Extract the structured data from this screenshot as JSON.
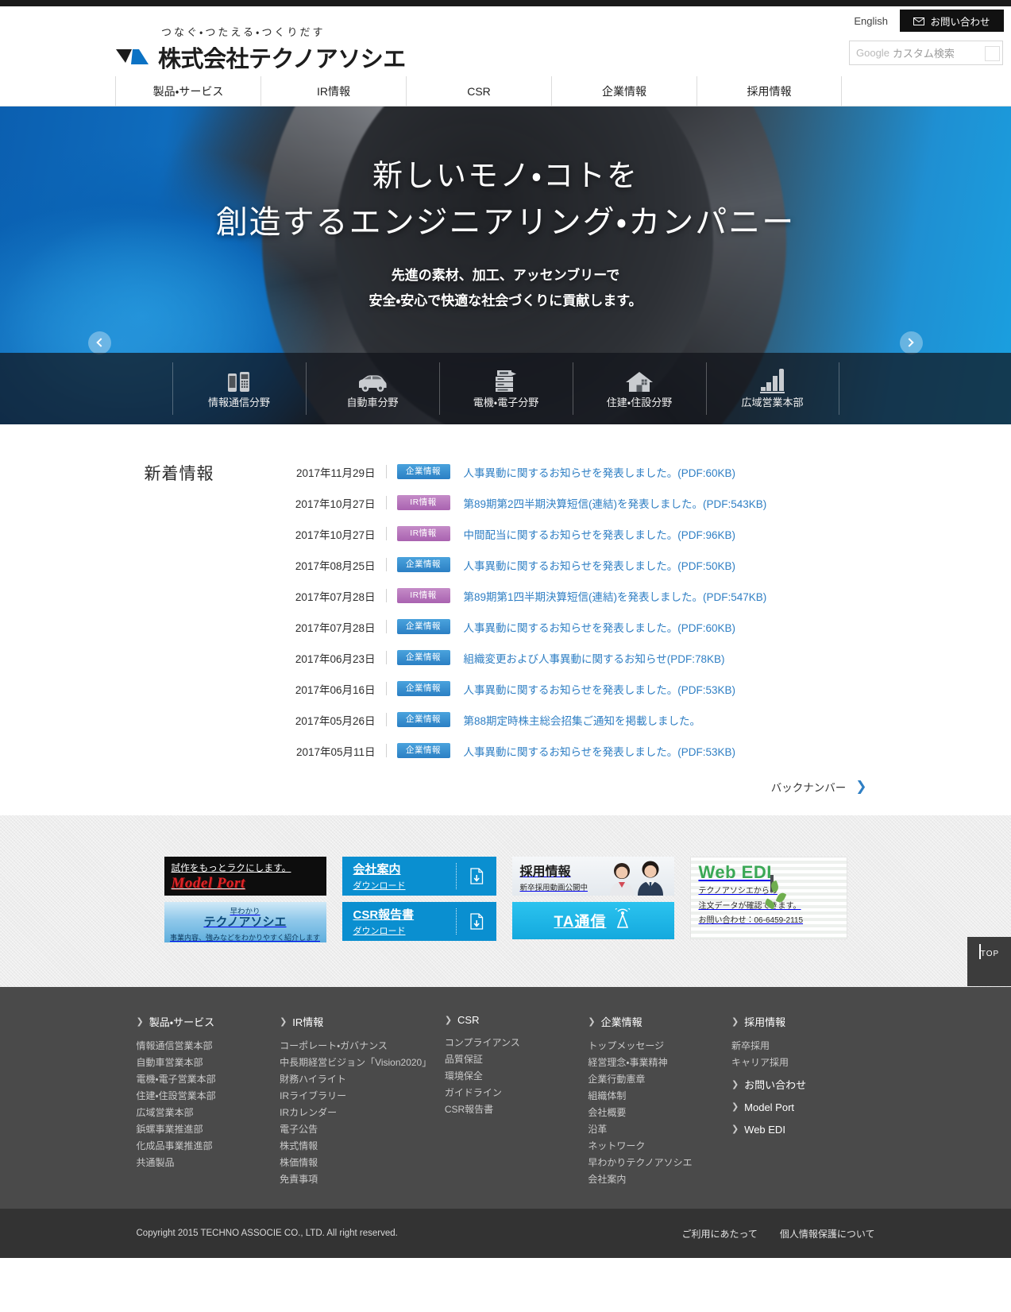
{
  "header": {
    "tagline": "つなぐ・つたえる・つくりだす",
    "company_name": "株式会社テクノアソシエ",
    "english_link": "English",
    "contact_label": "お問い合わせ",
    "contact_icon": "mail-icon",
    "search": {
      "google_label": "Google",
      "placeholder": "カスタム検索",
      "icon": "search-icon"
    },
    "nav": [
      {
        "label": "製品・サービス"
      },
      {
        "label": "IR情報"
      },
      {
        "label": "CSR"
      },
      {
        "label": "企業情報"
      },
      {
        "label": "採用情報"
      }
    ]
  },
  "hero": {
    "headline_line1": "新しいモノ・コトを",
    "headline_line2": "創造するエンジニアリング・カンパニー",
    "sub_line1": "先進の素材、加工、アッセンブリーで",
    "sub_line2": "安全・安心で快適な社会づくりに貢献します。",
    "prev_icon": "chevron-left-icon",
    "next_icon": "chevron-right-icon"
  },
  "segments": [
    {
      "label": "情報通信分野",
      "icon": "smartphone-icon"
    },
    {
      "label": "自動車分野",
      "icon": "car-icon"
    },
    {
      "label": "電機・電子分野",
      "icon": "printer-icon"
    },
    {
      "label": "住建・住設分野",
      "icon": "house-icon"
    },
    {
      "label": "広域営業本部",
      "icon": "bar-chart-icon"
    }
  ],
  "news": {
    "title": "新着情報",
    "backnumber_label": "バックナンバー",
    "backnumber_icon": "chevron-right-icon",
    "items": [
      {
        "date": "2017年11月29日",
        "category": "企業情報",
        "type": "corp",
        "text": "人事異動に関するお知らせを発表しました。(PDF:60KB)"
      },
      {
        "date": "2017年10月27日",
        "category": "IR情報",
        "type": "ir",
        "text": "第89期第2四半期決算短信(連結)を発表しました。(PDF:543KB)"
      },
      {
        "date": "2017年10月27日",
        "category": "IR情報",
        "type": "ir",
        "text": "中間配当に関するお知らせを発表しました。(PDF:96KB)"
      },
      {
        "date": "2017年08月25日",
        "category": "企業情報",
        "type": "corp",
        "text": "人事異動に関するお知らせを発表しました。(PDF:50KB)"
      },
      {
        "date": "2017年07月28日",
        "category": "IR情報",
        "type": "ir",
        "text": "第89期第1四半期決算短信(連結)を発表しました。(PDF:547KB)"
      },
      {
        "date": "2017年07月28日",
        "category": "企業情報",
        "type": "corp",
        "text": "人事異動に関するお知らせを発表しました。(PDF:60KB)"
      },
      {
        "date": "2017年06月23日",
        "category": "企業情報",
        "type": "corp",
        "text": "組織変更および人事異動に関するお知らせ(PDF:78KB)"
      },
      {
        "date": "2017年06月16日",
        "category": "企業情報",
        "type": "corp",
        "text": "人事異動に関するお知らせを発表しました。(PDF:53KB)"
      },
      {
        "date": "2017年05月26日",
        "category": "企業情報",
        "type": "corp",
        "text": "第88期定時株主総会招集ご通知を掲載しました。"
      },
      {
        "date": "2017年05月11日",
        "category": "企業情報",
        "type": "corp",
        "text": "人事異動に関するお知らせを発表しました。(PDF:53KB)"
      }
    ]
  },
  "banners": {
    "model_port": {
      "caption": "試作をもっとラクにします。",
      "brand": "Model Port"
    },
    "hayawakari": {
      "small": "早わかり",
      "title": "テクノアソシエ",
      "caption": "事業内容、強みなどをわかりやすく紹介します"
    },
    "company_guide": {
      "title": "会社案内",
      "sub": "ダウンロード",
      "icon": "download-icon"
    },
    "csr_report": {
      "title": "CSR報告書",
      "sub": "ダウンロード",
      "icon": "download-icon"
    },
    "recruit": {
      "title": "採用情報",
      "sub": "新卒採用動画公開中"
    },
    "ta_tsushin": {
      "title": "TA通信",
      "icon": "antenna-icon"
    },
    "web_edi": {
      "title": "Web EDI",
      "line1": "テクノアソシエからの",
      "line2": "注文データが確認できます。",
      "line3": "お問い合わせ：06-6459-2115"
    }
  },
  "footer": {
    "columns": [
      {
        "heading": "製品・サービス",
        "links": [
          "情報通信営業本部",
          "自動車営業本部",
          "電機・電子営業本部",
          "住建・住設営業本部",
          "広域営業本部",
          "鋲螺事業推進部",
          "化成品事業推進部",
          "共通製品"
        ]
      },
      {
        "heading": "IR情報",
        "links": [
          "コーポレート・ガバナンス",
          "中長期経営ビジョン「Vision2020」",
          "財務ハイライト",
          "IRライブラリー",
          "IRカレンダー",
          "電子公告",
          "株式情報",
          "株価情報",
          "免責事項"
        ]
      },
      {
        "heading": "CSR",
        "links": [
          "コンプライアンス",
          "品質保証",
          "環境保全",
          "ガイドライン",
          "CSR報告書"
        ]
      },
      {
        "heading": "企業情報",
        "links": [
          "トップメッセージ",
          "経営理念・事業精神",
          "企業行動憲章",
          "組織体制",
          "会社概要",
          "沿革",
          "ネットワーク",
          "早わかりテクノアソシエ",
          "会社案内"
        ]
      },
      {
        "heading": "採用情報",
        "links": [
          "新卒採用",
          "キャリア採用"
        ],
        "extra_links": [
          "お問い合わせ",
          "Model Port",
          "Web EDI"
        ]
      }
    ],
    "copyright": "Copyright 2015 TECHNO ASSOCIE CO., LTD. All right reserved.",
    "bottom_links": [
      "ご利用にあたって",
      "個人情報保護について"
    ]
  },
  "top_button": {
    "label": "TOP",
    "icon": "chevron-up-icon"
  }
}
